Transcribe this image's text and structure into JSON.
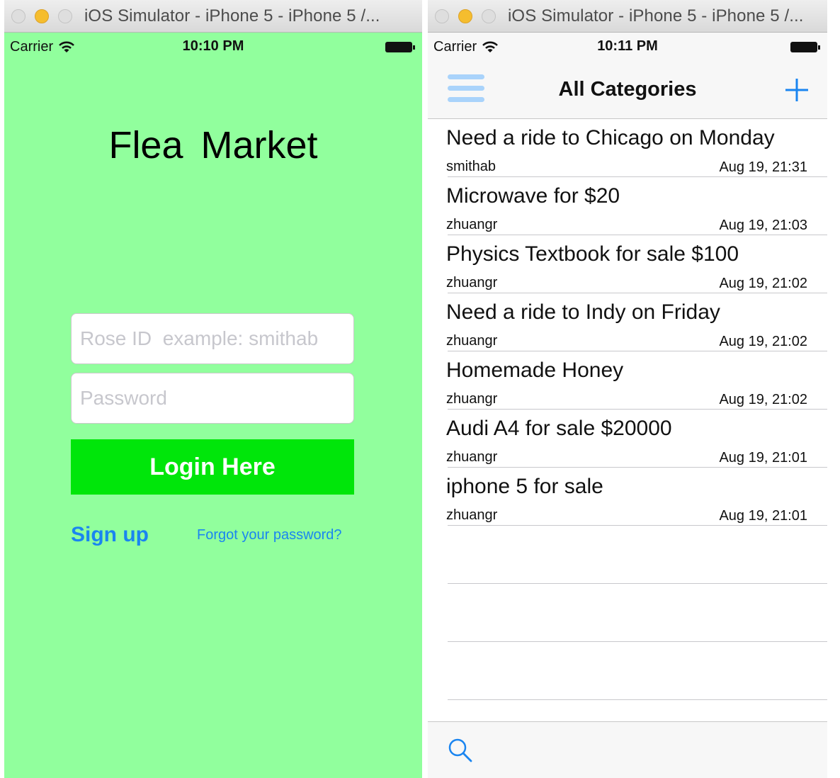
{
  "colors": {
    "login_background": "#91ff9d",
    "login_button": "#00e60a",
    "link_blue": "#1a85f0",
    "menu_icon": "#a9d3fb"
  },
  "left_window": {
    "title": "iOS Simulator - iPhone 5 - iPhone 5 /...",
    "status": {
      "carrier": "Carrier",
      "time": "10:10 PM"
    },
    "app_title": "Flea  Market",
    "rose_id": {
      "placeholder": "Rose ID  example: smithab",
      "value": ""
    },
    "password": {
      "placeholder": "Password",
      "value": ""
    },
    "login_label": "Login Here",
    "signup_label": "Sign up",
    "forgot_label": "Forgot your password?"
  },
  "right_window": {
    "title": "iOS Simulator - iPhone 5 - iPhone 5 /...",
    "status": {
      "carrier": "Carrier",
      "time": "10:11 PM"
    },
    "nav_title": "All Categories",
    "icons": {
      "menu": "hamburger-menu-icon",
      "add": "plus-icon",
      "search": "search-icon"
    },
    "posts": [
      {
        "title": "Need a ride to Chicago on Monday",
        "user": "smithab",
        "date": "Aug 19, 21:31"
      },
      {
        "title": "Microwave for $20",
        "user": "zhuangr",
        "date": "Aug 19, 21:03"
      },
      {
        "title": "Physics Textbook for sale $100",
        "user": "zhuangr",
        "date": "Aug 19, 21:02"
      },
      {
        "title": "Need a ride to Indy on Friday",
        "user": "zhuangr",
        "date": "Aug 19, 21:02"
      },
      {
        "title": "Homemade Honey",
        "user": "zhuangr",
        "date": "Aug 19, 21:02"
      },
      {
        "title": "Audi A4 for sale $20000",
        "user": "zhuangr",
        "date": "Aug 19, 21:01"
      },
      {
        "title": "iphone 5 for sale",
        "user": "zhuangr",
        "date": "Aug 19, 21:01"
      }
    ]
  }
}
